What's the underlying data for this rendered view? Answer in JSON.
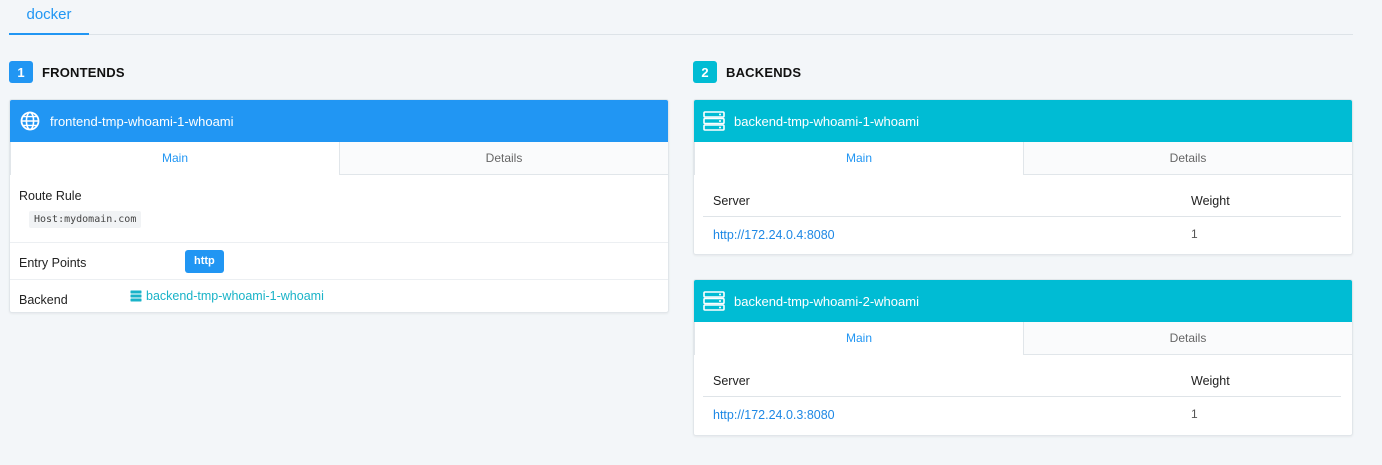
{
  "provider_tab": {
    "label": "docker"
  },
  "colors": {
    "frontend": "#2196f3",
    "backend": "#00bcd4"
  },
  "frontends_section": {
    "count": "1",
    "title": "FRONTENDS"
  },
  "backends_section": {
    "count": "2",
    "title": "BACKENDS"
  },
  "frontend": {
    "name": "frontend-tmp-whoami-1-whoami",
    "icon": "globe-icon",
    "tabs": [
      {
        "label": "Main",
        "active": true
      },
      {
        "label": "Details",
        "active": false
      }
    ],
    "route_rule_label": "Route Rule",
    "route_rule_value": "Host:mydomain.com",
    "entry_points_label": "Entry Points",
    "entry_points": [
      "http"
    ],
    "backend_label": "Backend",
    "backend_value": "backend-tmp-whoami-1-whoami"
  },
  "backends": [
    {
      "name": "backend-tmp-whoami-1-whoami",
      "icon": "server-icon",
      "tabs": [
        {
          "label": "Main",
          "active": true
        },
        {
          "label": "Details",
          "active": false
        }
      ],
      "columns": {
        "server": "Server",
        "weight": "Weight"
      },
      "servers": [
        {
          "url": "http://172.24.0.4:8080",
          "weight": "1"
        }
      ]
    },
    {
      "name": "backend-tmp-whoami-2-whoami",
      "icon": "server-icon",
      "tabs": [
        {
          "label": "Main",
          "active": true
        },
        {
          "label": "Details",
          "active": false
        }
      ],
      "columns": {
        "server": "Server",
        "weight": "Weight"
      },
      "servers": [
        {
          "url": "http://172.24.0.3:8080",
          "weight": "1"
        }
      ]
    }
  ]
}
